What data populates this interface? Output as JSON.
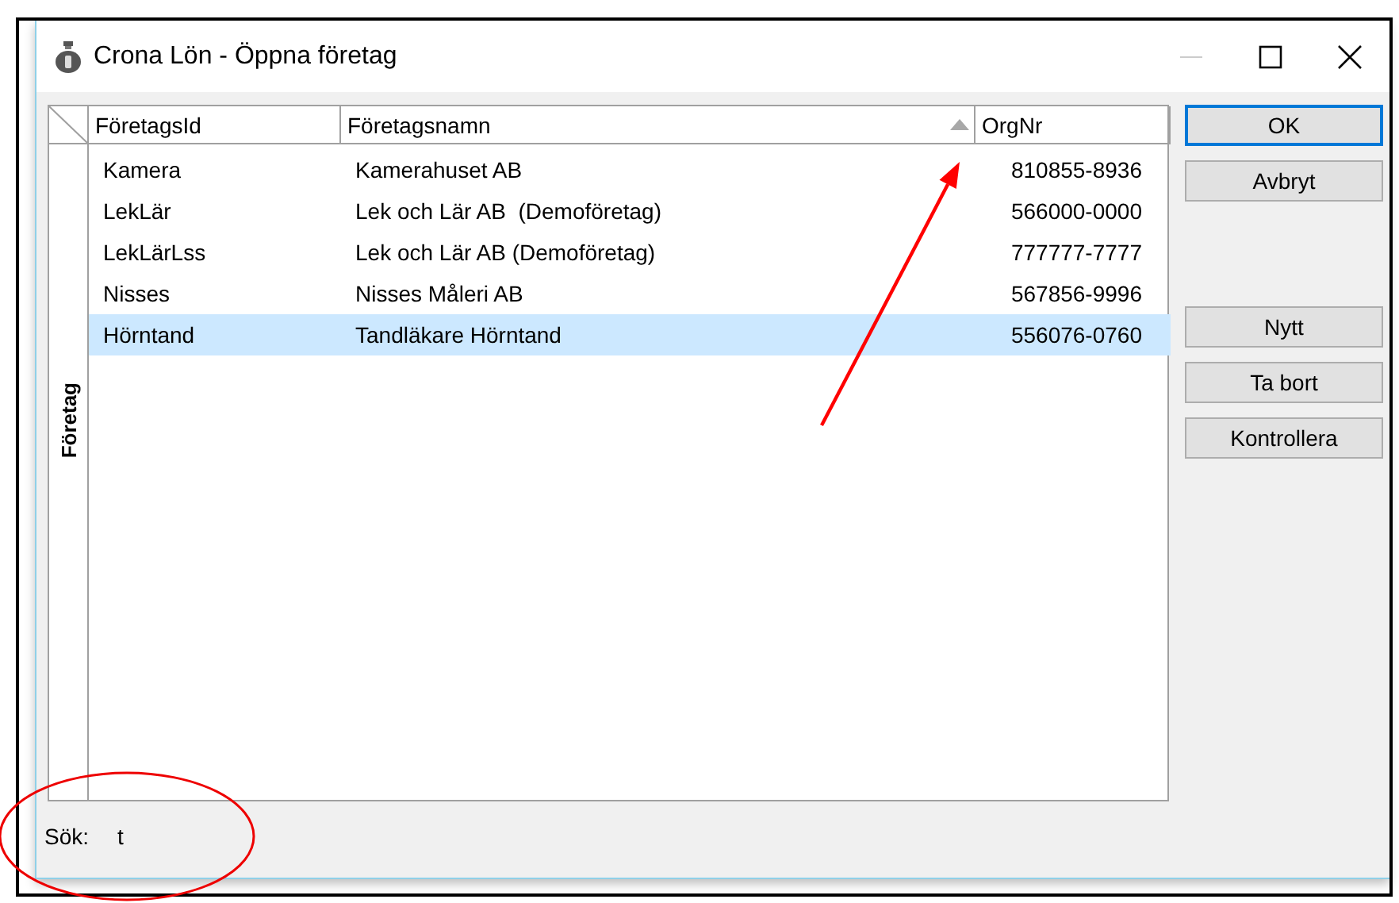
{
  "window": {
    "title": "Crona Lön - Öppna företag"
  },
  "table": {
    "side_tab": "Företag",
    "columns": [
      {
        "label": "FöretagsId",
        "sorted": false
      },
      {
        "label": "Företagsnamn",
        "sorted": true
      },
      {
        "label": "OrgNr",
        "sorted": false
      }
    ],
    "rows": [
      {
        "cells": [
          "Kamera",
          "Kamerahuset AB",
          "810855-8936"
        ],
        "selected": false
      },
      {
        "cells": [
          "LekLär",
          "Lek och Lär AB  (Demoföretag)",
          "566000-0000"
        ],
        "selected": false
      },
      {
        "cells": [
          "LekLärLss",
          "Lek och Lär AB (Demoföretag)",
          "777777-7777"
        ],
        "selected": false
      },
      {
        "cells": [
          "Nisses",
          "Nisses Måleri AB",
          "567856-9996"
        ],
        "selected": false
      },
      {
        "cells": [
          "Hörntand",
          "Tandläkare Hörntand",
          "556076-0760"
        ],
        "selected": true
      }
    ]
  },
  "buttons": [
    {
      "label": "OK",
      "default": true
    },
    {
      "label": "Avbryt",
      "default": false
    },
    {
      "label": "Nytt",
      "default": false
    },
    {
      "label": "Ta bort",
      "default": false
    },
    {
      "label": "Kontrollera",
      "default": false
    }
  ],
  "search": {
    "label": "Sök:",
    "value": "t"
  },
  "annotations": [
    {
      "kind": "arrow"
    },
    {
      "kind": "ellipse"
    }
  ]
}
